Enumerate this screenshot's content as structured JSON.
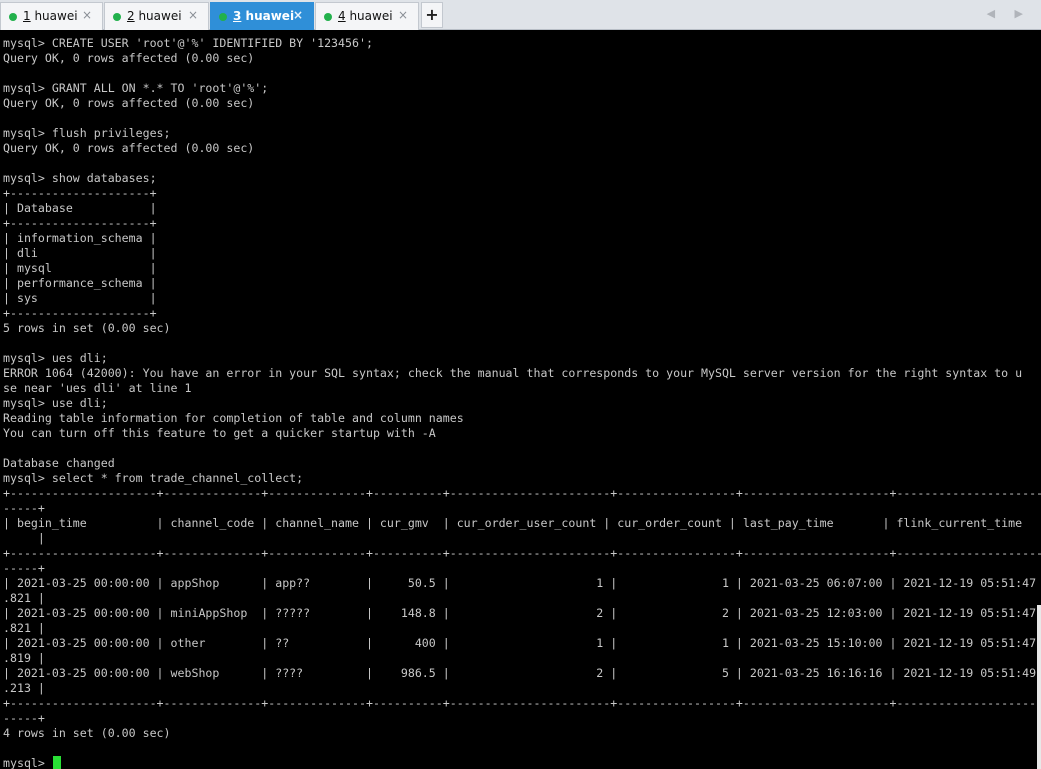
{
  "tabs": [
    {
      "num": "1",
      "label": " huawei",
      "close": "×"
    },
    {
      "num": "2",
      "label": " huawei",
      "close": "×"
    },
    {
      "num": "3",
      "label": " huawei",
      "close": "×"
    },
    {
      "num": "4",
      "label": " huawei",
      "close": "×"
    }
  ],
  "add_tab_label": "+",
  "nav_arrows": "◀ ▶",
  "terminal": {
    "output": "mysql> CREATE USER 'root'@'%' IDENTIFIED BY '123456';\nQuery OK, 0 rows affected (0.00 sec)\n\nmysql> GRANT ALL ON *.* TO 'root'@'%';\nQuery OK, 0 rows affected (0.00 sec)\n\nmysql> flush privileges;\nQuery OK, 0 rows affected (0.00 sec)\n\nmysql> show databases;\n+--------------------+\n| Database           |\n+--------------------+\n| information_schema |\n| dli                |\n| mysql              |\n| performance_schema |\n| sys                |\n+--------------------+\n5 rows in set (0.00 sec)\n\nmysql> ues dli;\nERROR 1064 (42000): You have an error in your SQL syntax; check the manual that corresponds to your MySQL server version for the right syntax to u\nse near 'ues dli' at line 1\nmysql> use dli;\nReading table information for completion of table and column names\nYou can turn off this feature to get a quicker startup with -A\n\nDatabase changed\nmysql> select * from trade_channel_collect;\n+---------------------+--------------+--------------+----------+-----------------------+-----------------+---------------------+----------------------\n-----+\n| begin_time          | channel_code | channel_name | cur_gmv  | cur_order_user_count | cur_order_count | last_pay_time       | flink_current_time\n     |\n+---------------------+--------------+--------------+----------+-----------------------+-----------------+---------------------+----------------------\n-----+\n| 2021-03-25 00:00:00 | appShop      | app??        |     50.5 |                     1 |               1 | 2021-03-25 06:07:00 | 2021-12-19 05:51:47\n.821 |\n| 2021-03-25 00:00:00 | miniAppShop  | ?????        |    148.8 |                     2 |               2 | 2021-03-25 12:03:00 | 2021-12-19 05:51:47\n.821 |\n| 2021-03-25 00:00:00 | other        | ??           |      400 |                     1 |               1 | 2021-03-25 15:10:00 | 2021-12-19 05:51:47\n.819 |\n| 2021-03-25 00:00:00 | webShop      | ????         |    986.5 |                     2 |               5 | 2021-03-25 16:16:16 | 2021-12-19 05:51:49\n.213 |\n+---------------------+--------------+--------------+----------+-----------------------+-----------------+---------------------+----------------------\n-----+\n4 rows in set (0.00 sec)\n",
    "prompt": "mysql> "
  },
  "colors": {
    "tab_active": "#2f8fd8",
    "status_dot": "#22b14c",
    "cursor": "#29e035",
    "terminal_bg": "#000000",
    "terminal_fg": "#c8c8c8"
  }
}
